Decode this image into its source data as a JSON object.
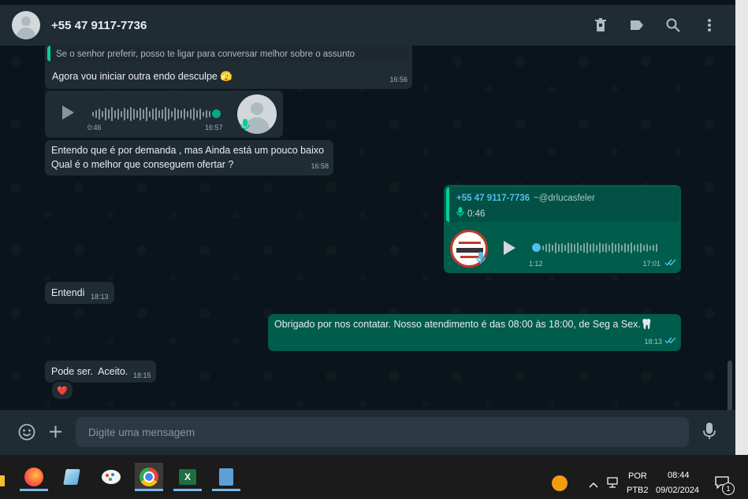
{
  "header": {
    "contact_name": "+55 47 9117-7736"
  },
  "messages": {
    "m1": {
      "quoted_text": "Se o senhor preferir, posso te ligar para conversar melhor sobre o assunto",
      "text": "Agora vou iniciar outra endo desculpe 🫣",
      "time": "16:56"
    },
    "m2": {
      "duration": "0:46",
      "time": "16:57"
    },
    "m3": {
      "line1": "Entendo que é por demanda , mas Ainda está um pouco baixo",
      "line2": "Qual é o melhor que conseguem ofertar ?",
      "time": "16:58"
    },
    "m4": {
      "quoted_author": "+55 47 9117-7736",
      "quoted_handle": "~@drlucasfeler",
      "quoted_duration": "0:46",
      "duration": "1:12",
      "time": "17:01"
    },
    "m5": {
      "text": "Entendi",
      "time": "18:13"
    },
    "m6": {
      "text": "Obrigado por nos contatar. Nosso atendimento é das 08:00 às 18:00, de Seg a Sex.🦷",
      "time": "18:13"
    },
    "m7": {
      "text": "Pode ser.  Aceito.",
      "time": "18:15",
      "reaction": "❤️"
    }
  },
  "footer": {
    "placeholder": "Digite uma mensagem"
  },
  "taskbar": {
    "lang_top": "POR",
    "lang_bottom": "PTB2",
    "clock_time": "08:44",
    "clock_date": "09/02/2024",
    "notification_count": "1"
  },
  "colors": {
    "header_bg": "#202c33",
    "outgoing": "#005c4b",
    "incoming": "#202c33",
    "accent": "#06cf9c",
    "read_ticks": "#53bdeb"
  },
  "icons": [
    "trash-icon",
    "label-icon",
    "search-icon",
    "more-icon",
    "emoji-icon",
    "plus-icon",
    "mic-icon",
    "play-icon",
    "chevron-down-icon"
  ]
}
